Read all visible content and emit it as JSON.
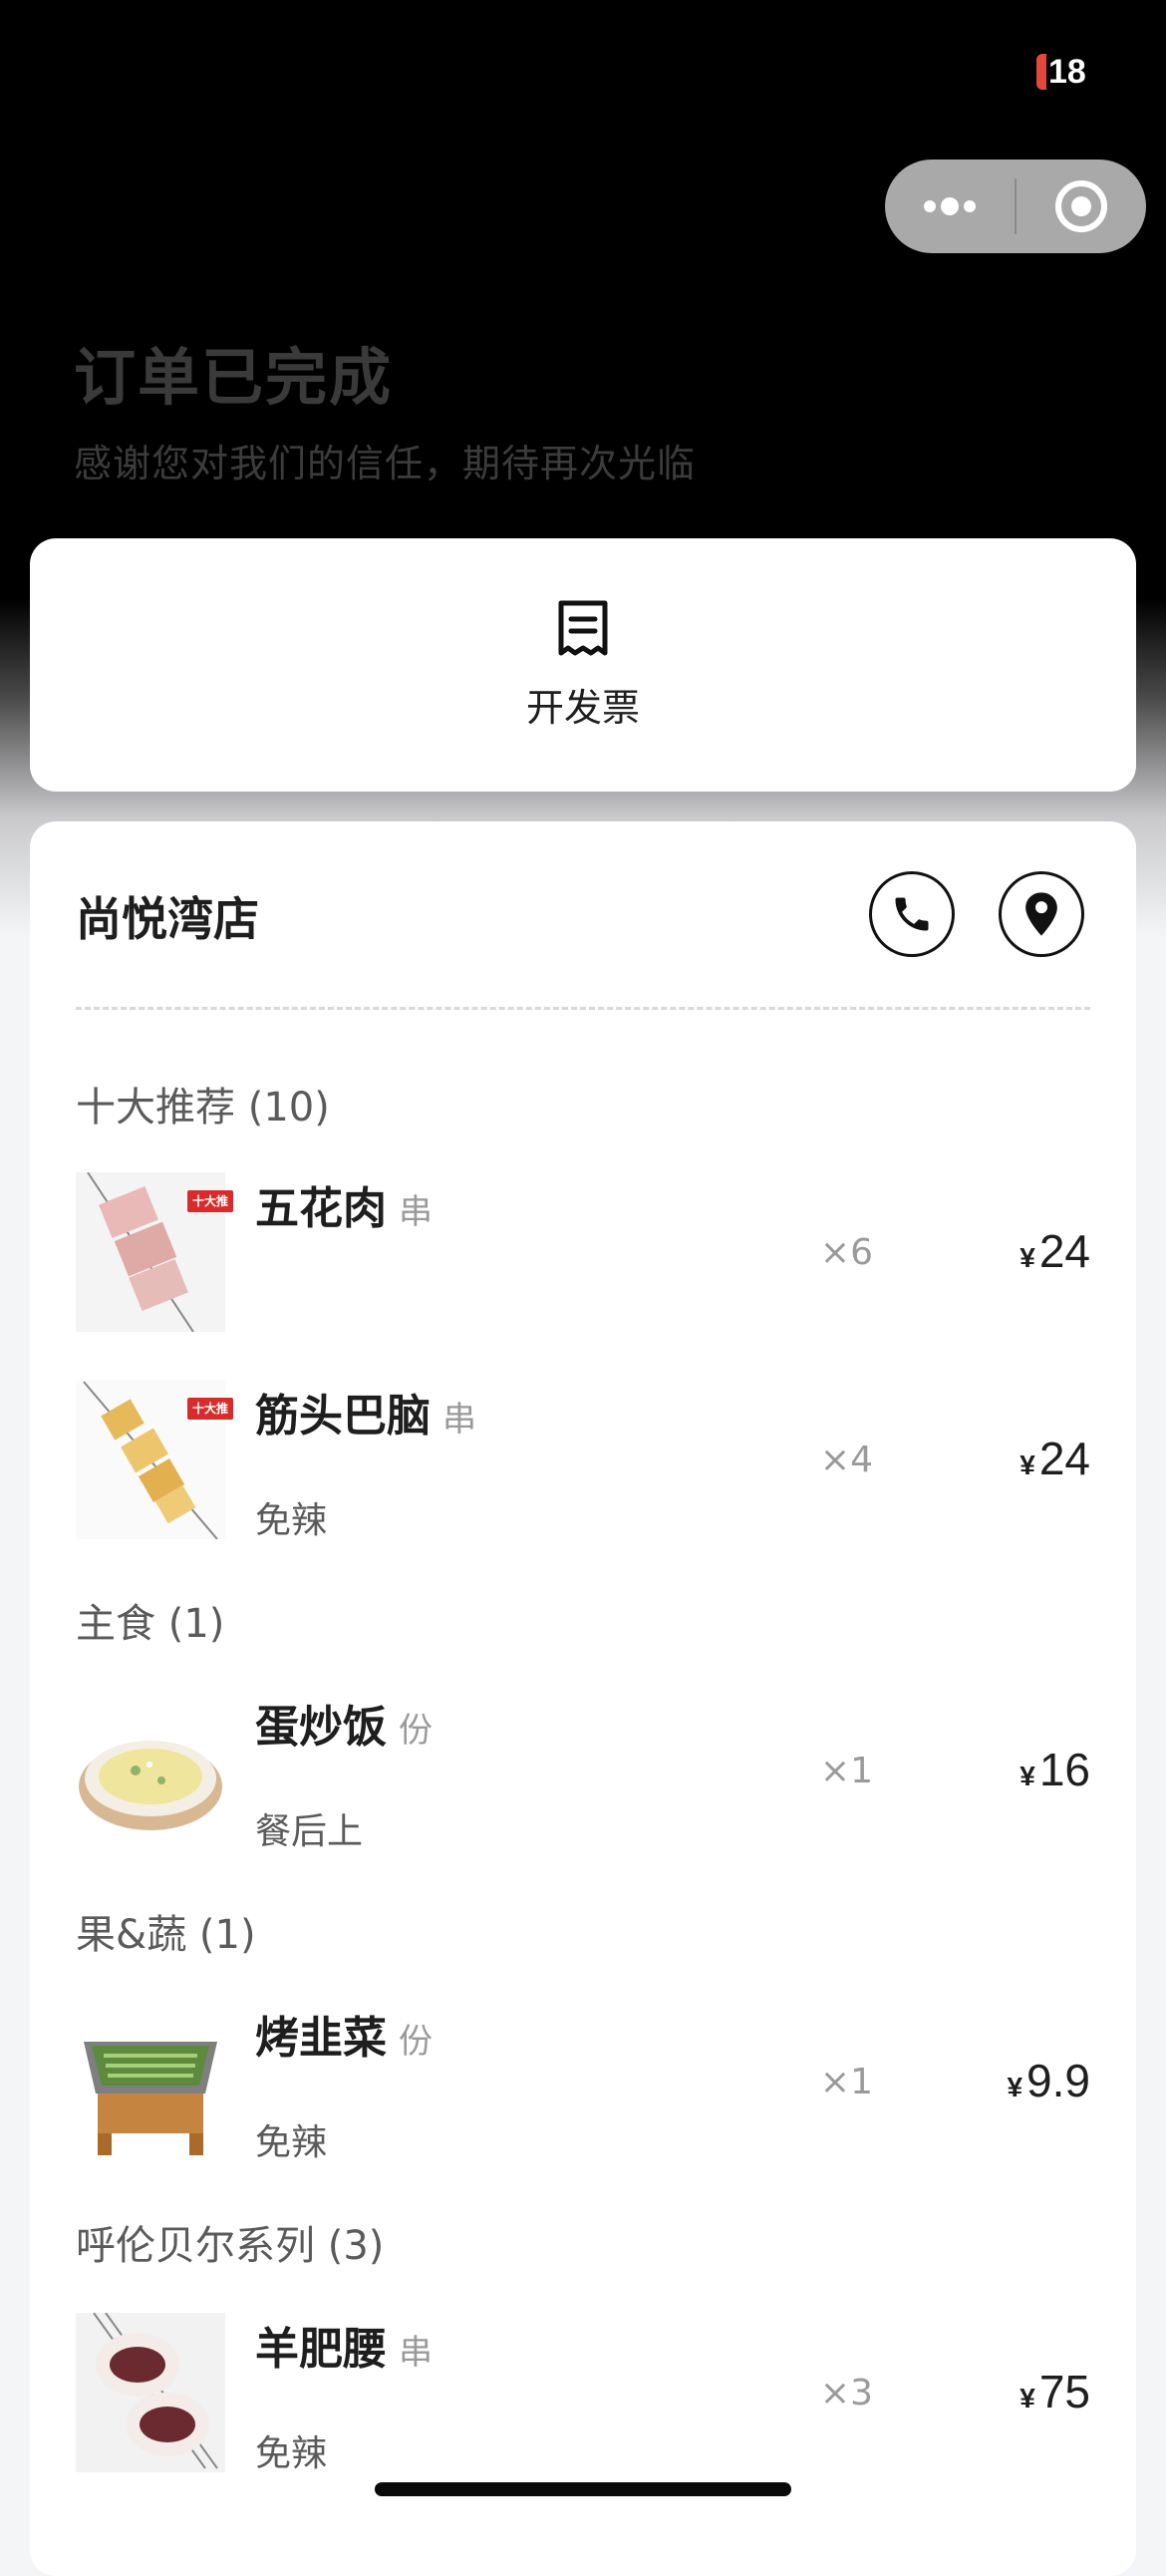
{
  "status_bar": {
    "battery": "18"
  },
  "header": {
    "title": "订单已完成",
    "subtitle": "感谢您对我们的信任，期待再次光临"
  },
  "invoice": {
    "label": "开发票"
  },
  "store": {
    "name": "尚悦湾店"
  },
  "badge_text": "十大推",
  "sections": [
    {
      "title": "十大推荐 (10)"
    },
    {
      "title": "主食 (1)"
    },
    {
      "title": "果&蔬 (1)"
    },
    {
      "title": "呼伦贝尔系列 (3)"
    }
  ],
  "items": [
    {
      "name": "五花肉",
      "unit": "串",
      "note": "",
      "qty": "×6",
      "currency": "¥",
      "price": "24"
    },
    {
      "name": "筋头巴脑",
      "unit": "串",
      "note": "免辣",
      "qty": "×4",
      "currency": "¥",
      "price": "24"
    },
    {
      "name": "蛋炒饭",
      "unit": "份",
      "note": "餐后上",
      "qty": "×1",
      "currency": "¥",
      "price": "16"
    },
    {
      "name": "烤韭菜",
      "unit": "份",
      "note": "免辣",
      "qty": "×1",
      "currency": "¥",
      "price": "9.9"
    },
    {
      "name": "羊肥腰",
      "unit": "串",
      "note": "免辣",
      "qty": "×3",
      "currency": "¥",
      "price": "75"
    }
  ],
  "colors": {
    "battery_low": "#e4483b",
    "badge_red": "#d92b2b"
  },
  "icons": [
    "more-dots-icon",
    "close-target-icon",
    "receipt-icon",
    "phone-icon",
    "location-pin-icon"
  ]
}
